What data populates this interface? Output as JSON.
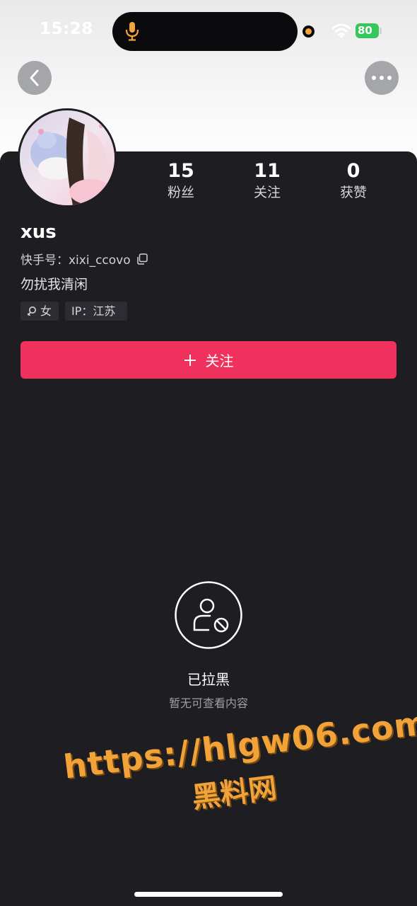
{
  "status_bar": {
    "time": "15:28",
    "battery_level": "80",
    "icons": [
      "microphone-icon",
      "camera-indicator-icon",
      "wifi-icon",
      "battery-icon"
    ]
  },
  "header": {
    "back_icon": "chevron-left-icon",
    "more_icon": "more-dots-icon"
  },
  "profile": {
    "username": "xus",
    "kuaishou_id": "快手号：xixi_ccovo",
    "bio": "勿扰我清闲",
    "stats": [
      {
        "value": "15",
        "label": "粉丝"
      },
      {
        "value": "11",
        "label": "关注"
      },
      {
        "value": "0",
        "label": "获赞"
      }
    ],
    "tags": {
      "gender": "女",
      "ip": "IP：江苏"
    }
  },
  "follow_button": {
    "label": "关注",
    "icon": "plus-icon"
  },
  "blocked_state": {
    "icon": "user-blocked-icon",
    "title": "已拉黑",
    "subtitle": "暂无可查看内容"
  },
  "watermark": {
    "url": "https://hlgw06.com",
    "name": "黑料网"
  },
  "colors": {
    "background": "#1e1d22",
    "accent": "#f0315e",
    "watermark": "#f1a33a",
    "battery": "#34c759"
  }
}
